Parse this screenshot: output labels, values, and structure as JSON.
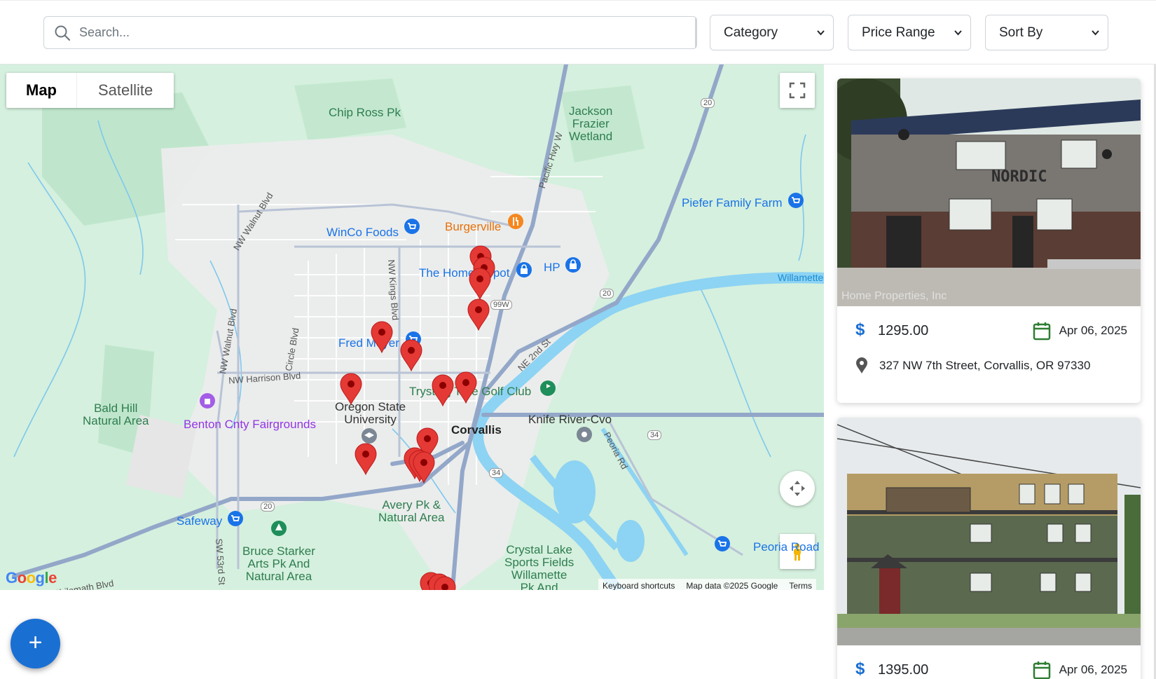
{
  "search": {
    "placeholder": "Search..."
  },
  "filters": {
    "category": "Category",
    "price_range": "Price Range",
    "sort_by": "Sort By"
  },
  "map": {
    "type_controls": {
      "map": "Map",
      "satellite": "Satellite"
    },
    "labels": {
      "chip_ross": "Chip Ross Pk",
      "jackson": "Jackson\nFrazier\nWetland",
      "piefer": "Piefer Family Farm",
      "winco": "WinCo Foods",
      "burgerville": "Burgerville",
      "home_depot": "The Home Depot",
      "hp": "HP",
      "willamette": "Willamette",
      "fred_meyer": "Fred Meyer",
      "trysting": "Trysting Tree Golf Club",
      "osu": "Oregon State\nUniversity",
      "corvallis": "Corvallis",
      "knife_river": "Knife River-Cvo",
      "bald_hill": "Bald Hill\nNatural Area",
      "fairgrounds": "Benton Cnty Fairgrounds",
      "avery": "Avery Pk &\nNatural Area",
      "safeway": "Safeway",
      "bruce": "Bruce Starker\nArts Pk And\nNatural Area",
      "crystal": "Crystal Lake\nSports Fields\nWillamette\nPk And",
      "peoria": "Peoria Road",
      "walnut1": "NW Walnut Blvd",
      "walnut2": "NW Walnut Blvd",
      "circle": "Circle Blvd",
      "harrison": "NW Harrison Blvd",
      "kings": "NW Kings Blvd",
      "pacific": "Pacific Hwy W",
      "ne2nd": "NE 2nd St",
      "peoria_rd": "Peoria Rd",
      "sw53": "SW 53rd St",
      "philomath": "Philomath Blvd",
      "r20a": "20",
      "r20b": "20",
      "r20c": "20",
      "r99w": "99W",
      "r34a": "34",
      "r34b": "34"
    },
    "attribution": {
      "shortcuts": "Keyboard shortcuts",
      "data": "Map data ©2025 Google",
      "terms": "Terms"
    },
    "logo": "Google",
    "marker_color": "#e53935",
    "marker_count": 19
  },
  "listings": [
    {
      "price": "1295.00",
      "date": "Apr 06, 2025",
      "address": "327 NW 7th Street, Corvallis, OR 97330",
      "sign": "NORDIC",
      "watermark": "Home Properties, Inc"
    },
    {
      "price": "1395.00",
      "date": "Apr 06, 2025"
    }
  ],
  "colors": {
    "accent": "#1a6fd3",
    "calendar": "#2e7d32",
    "price_icon": "#1a6fd3"
  },
  "fab": {
    "label": "+"
  }
}
